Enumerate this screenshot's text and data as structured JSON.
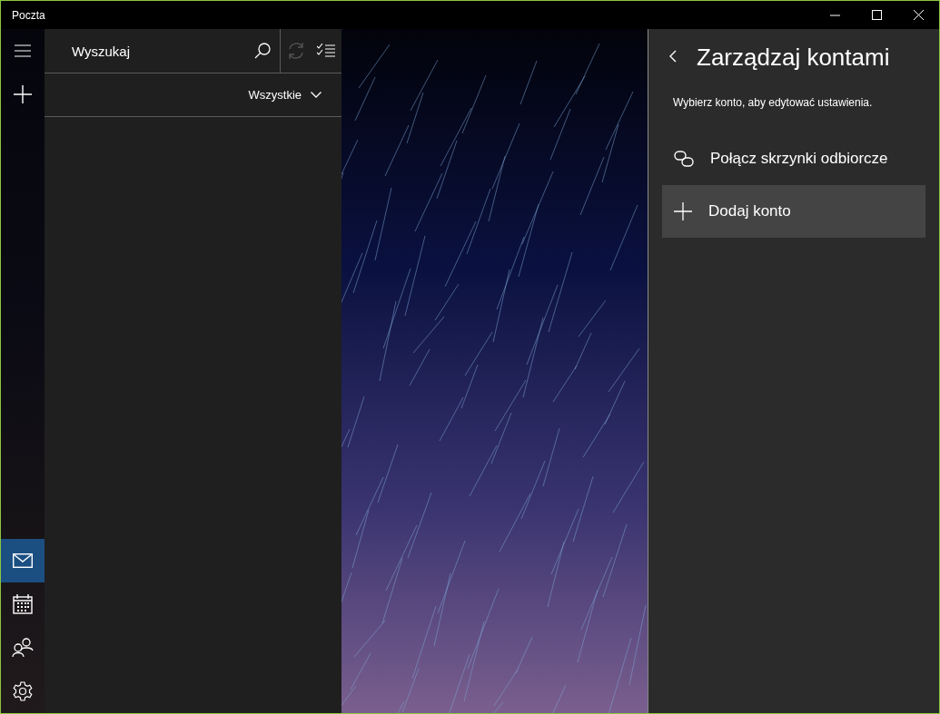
{
  "window": {
    "title": "Poczta"
  },
  "nav": {
    "top": [
      {
        "kind": "menu"
      },
      {
        "kind": "new"
      }
    ],
    "bottom": [
      {
        "kind": "mail",
        "selected": true
      },
      {
        "kind": "calendar",
        "selected": false
      },
      {
        "kind": "people",
        "selected": false
      },
      {
        "kind": "settings",
        "selected": false
      }
    ]
  },
  "search": {
    "placeholder": "Wyszukaj"
  },
  "filter": {
    "label": "Wszystkie"
  },
  "panel": {
    "title": "Zarządzaj kontami",
    "subtitle": "Wybierz konto, aby edytować ustawienia.",
    "actions": [
      {
        "kind": "link",
        "label": "Połącz skrzynki odbiorcze",
        "selected": false
      },
      {
        "kind": "add",
        "label": "Dodaj konto",
        "selected": true
      }
    ]
  }
}
